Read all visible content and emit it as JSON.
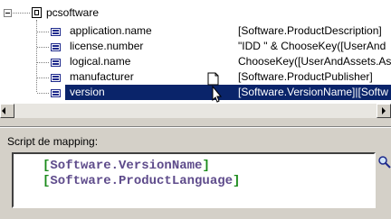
{
  "tree": {
    "root": {
      "label": "pcsoftware",
      "expander_icon": "minus-box",
      "icon": "database-icon"
    },
    "fields": [
      {
        "label": "application.name",
        "value": "[Software.ProductDescription]"
      },
      {
        "label": "license.number",
        "value": "\"IDD \" & ChooseKey([UserAnd"
      },
      {
        "label": "logical.name",
        "value": "ChooseKey([UserAndAssets.As"
      },
      {
        "label": "manufacturer",
        "value": "[Software.ProductPublisher]"
      },
      {
        "label": "version",
        "value": "[Software.VersionName]|[Softw",
        "selected": true
      }
    ]
  },
  "scrollbar": {
    "left_arrow": "left-arrow",
    "right_arrow": "right-arrow"
  },
  "script": {
    "label": "Script de mapping:",
    "lines": [
      "Software.VersionName",
      "Software.ProductLanguage"
    ]
  },
  "colors": {
    "selection": "#0a246a",
    "script_text": "#5e4b8b",
    "brackets": "#1a8a1a"
  }
}
